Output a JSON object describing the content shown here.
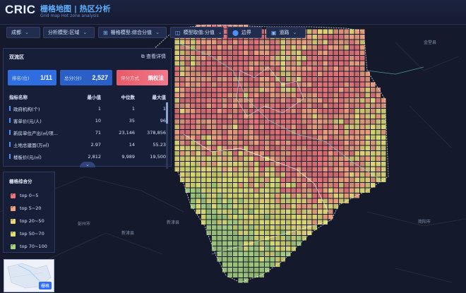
{
  "header": {
    "logo": "CRIC",
    "title": "栅格地图 | 热区分析",
    "subtitle": "Grid map Hot zone analysis"
  },
  "toolbar": {
    "city": "成都",
    "analysis_model": "分析模型:区域",
    "grid_model": "栅格模型:综合分值",
    "model_value": "模型取值:分值",
    "boundary": "边界",
    "road": "道路"
  },
  "panel": {
    "title": "双流区",
    "detail_link": "查看详情",
    "rank_label": "排名(位)",
    "rank_value": "1/11",
    "score_label": "总分(分)",
    "score_value": "2,527",
    "method_label": "评分方式",
    "method_value": "熵权法",
    "table": {
      "headers": [
        "指标名称",
        "最小值",
        "中位数",
        "最大值"
      ],
      "rows": [
        [
          "政府机构(个)",
          "1",
          "1",
          "1"
        ],
        [
          "客单价(元/人)",
          "10",
          "35",
          "96"
        ],
        [
          "新房单位产出(㎡/项...",
          "71",
          "23,146",
          "378,856"
        ],
        [
          "土地总建面(万㎡)",
          "2.97",
          "14",
          "55.23"
        ],
        [
          "楼板价(元/㎡)",
          "2,812",
          "9,989",
          "19,500"
        ]
      ]
    }
  },
  "legend": {
    "title": "栅格综合分",
    "items": [
      {
        "label": "top 0~5",
        "color": "#e8767a"
      },
      {
        "label": "top 5~20",
        "color": "#f2a27f"
      },
      {
        "label": "top 20~50",
        "color": "#e8d978"
      },
      {
        "label": "top 50~70",
        "color": "#dede72"
      },
      {
        "label": "top 70~100",
        "color": "#a6d07e"
      }
    ]
  },
  "minimap": {
    "label": "栅格"
  },
  "places": {
    "p1": "金堂县",
    "p2": "新津县",
    "p3": "新津县",
    "p4": "简阳市",
    "p5": "彭州市"
  }
}
